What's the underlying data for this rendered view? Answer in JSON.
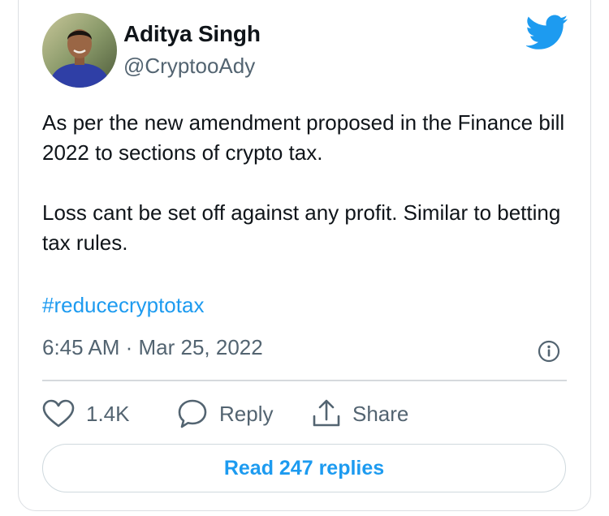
{
  "tweet": {
    "author_name": "Aditya Singh",
    "author_handle": "@CryptooAdy",
    "paragraphs": [
      "As per the new amendment proposed in the Finance bill 2022 to sections of crypto tax.",
      "Loss cant be set off against any profit. Similar to betting tax rules."
    ],
    "hashtag": "#reducecryptotax",
    "timestamp": "6:45 AM · Mar 25, 2022"
  },
  "actions": {
    "like_count": "1.4K",
    "reply_label": "Reply",
    "share_label": "Share"
  },
  "read_replies_label": "Read 247 replies",
  "icons": {
    "brand": "twitter-bird-icon",
    "info": "info-icon",
    "like": "heart-icon",
    "reply": "speech-bubble-icon",
    "share": "share-icon"
  },
  "colors": {
    "accent": "#1d9bf0",
    "text": "#0f1419",
    "muted": "#536471",
    "avatar_shirt": "#2f3fa6"
  }
}
